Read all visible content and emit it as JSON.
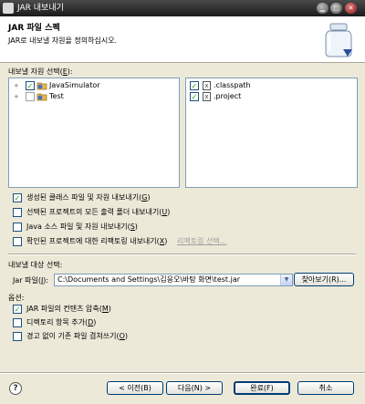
{
  "window": {
    "title": "JAR 내보내기",
    "help_label": "?",
    "min_label": "▁",
    "max_label": "□",
    "close_label": "✕"
  },
  "banner": {
    "title": "JAR 파일 스펙",
    "description": "JAR로 내보낼 자원을 정의하십시오."
  },
  "resources": {
    "label": "내보낼 자원 선택(",
    "mnemonic": "E",
    "label_end": "):",
    "tree": [
      {
        "name": "JavaSimulator",
        "checked": true,
        "twisty": "+"
      },
      {
        "name": "Test",
        "checked": false,
        "twisty": "+"
      }
    ],
    "files": [
      {
        "name": ".classpath",
        "checked": true,
        "icon": "x"
      },
      {
        "name": ".project",
        "checked": true,
        "icon": "x"
      }
    ]
  },
  "options_top": [
    {
      "text": "생성된 클래스 파일 및 자원 내보내기(",
      "mn": "G",
      "end": ")",
      "checked": true
    },
    {
      "text": "선택된 프로젝트의 모든 출력 폴더 내보내기(",
      "mn": "U",
      "end": ")",
      "checked": false
    },
    {
      "text": "Java 소스 파일 및 자원 내보내기(",
      "mn": "S",
      "end": ")",
      "checked": false
    },
    {
      "text": "확인된 프로젝트에 대한 리팩토링 내보내기(",
      "mn": "X",
      "end": ")",
      "checked": false
    }
  ],
  "refactor_link": "리팩토링 선택...",
  "destination": {
    "label": "내보낼 대상 선택:",
    "jar_label": "Jar 파일(",
    "jar_mn": "J",
    "jar_end": "):",
    "jar_value": "C:\\Documents and Settings\\김응오\\바탕 화면\\test.jar",
    "browse_label": "찾아보기(R)..."
  },
  "options": {
    "label": "옵션:",
    "items": [
      {
        "text": "JAR 파일의 컨텐츠 압축(",
        "mn": "M",
        "end": ")",
        "checked": true
      },
      {
        "text": "디렉토리 항목 추가(",
        "mn": "D",
        "end": ")",
        "checked": false
      },
      {
        "text": "경고 없이 기존 파일 겹쳐쓰기(",
        "mn": "O",
        "end": ")",
        "checked": false
      }
    ]
  },
  "buttons": {
    "back": "< 이전(B)",
    "next": "다음(N) >",
    "finish": "완료(F)",
    "cancel": "취소"
  },
  "colors": {
    "accent": "#7f9db9",
    "check": "#21a121",
    "title_bg": "#1b1b1b"
  },
  "icons": {
    "help": "help-icon",
    "jar": "jar-icon",
    "project": "java-project-icon",
    "file": "xml-file-icon"
  }
}
